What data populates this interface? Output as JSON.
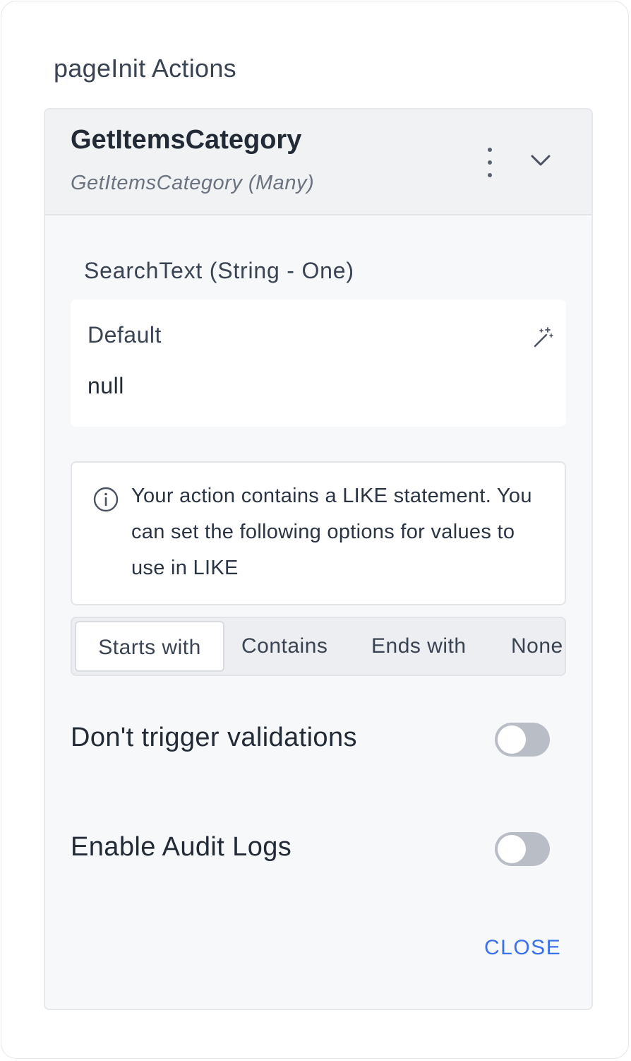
{
  "section_title": "pageInit Actions",
  "action": {
    "name": "GetItemsCategory",
    "subtitle": "GetItemsCategory (Many)"
  },
  "parameter": {
    "label": "SearchText (String - One)",
    "field_label": "Default",
    "value": "null"
  },
  "info": {
    "text": "Your action contains a LIKE statement. You can set the following options for values to use in LIKE"
  },
  "like_options": {
    "selected": "Starts with",
    "options": [
      "Starts with",
      "Contains",
      "Ends with",
      "None"
    ]
  },
  "settings": {
    "dont_trigger_validations": {
      "label": "Don't trigger validations",
      "enabled": false
    },
    "enable_audit_logs": {
      "label": "Enable Audit Logs",
      "enabled": false
    }
  },
  "close_label": "CLOSE",
  "icons": {
    "menu": "kebab-menu-icon",
    "collapse": "chevron-down-icon",
    "magic": "magic-wand-icon",
    "info": "info-icon"
  },
  "colors": {
    "accent": "#3b72e8",
    "toggle_off": "#b9bec6"
  }
}
